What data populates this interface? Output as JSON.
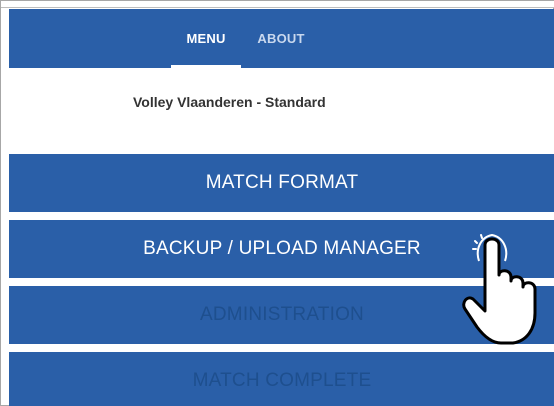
{
  "tabs": [
    {
      "label": "MENU",
      "selected": true
    },
    {
      "label": "ABOUT",
      "selected": false
    }
  ],
  "info": {
    "text": "Volley Vlaanderen - Standard"
  },
  "menu": {
    "match_format": "MATCH FORMAT",
    "backup_upload_manager": "BACKUP / UPLOAD MANAGER",
    "administration": "ADMINISTRATION",
    "match_complete": "MATCH COMPLETE"
  },
  "disabled_items": [
    "ADMINISTRATION",
    "MATCH COMPLETE"
  ],
  "colors": {
    "primary": "#2a5fa8",
    "text_on_primary": "#ffffff",
    "disabled_text": "#1e4f8e",
    "info_text": "#333333"
  },
  "icons": {
    "pointer": "tap-hand-icon"
  }
}
